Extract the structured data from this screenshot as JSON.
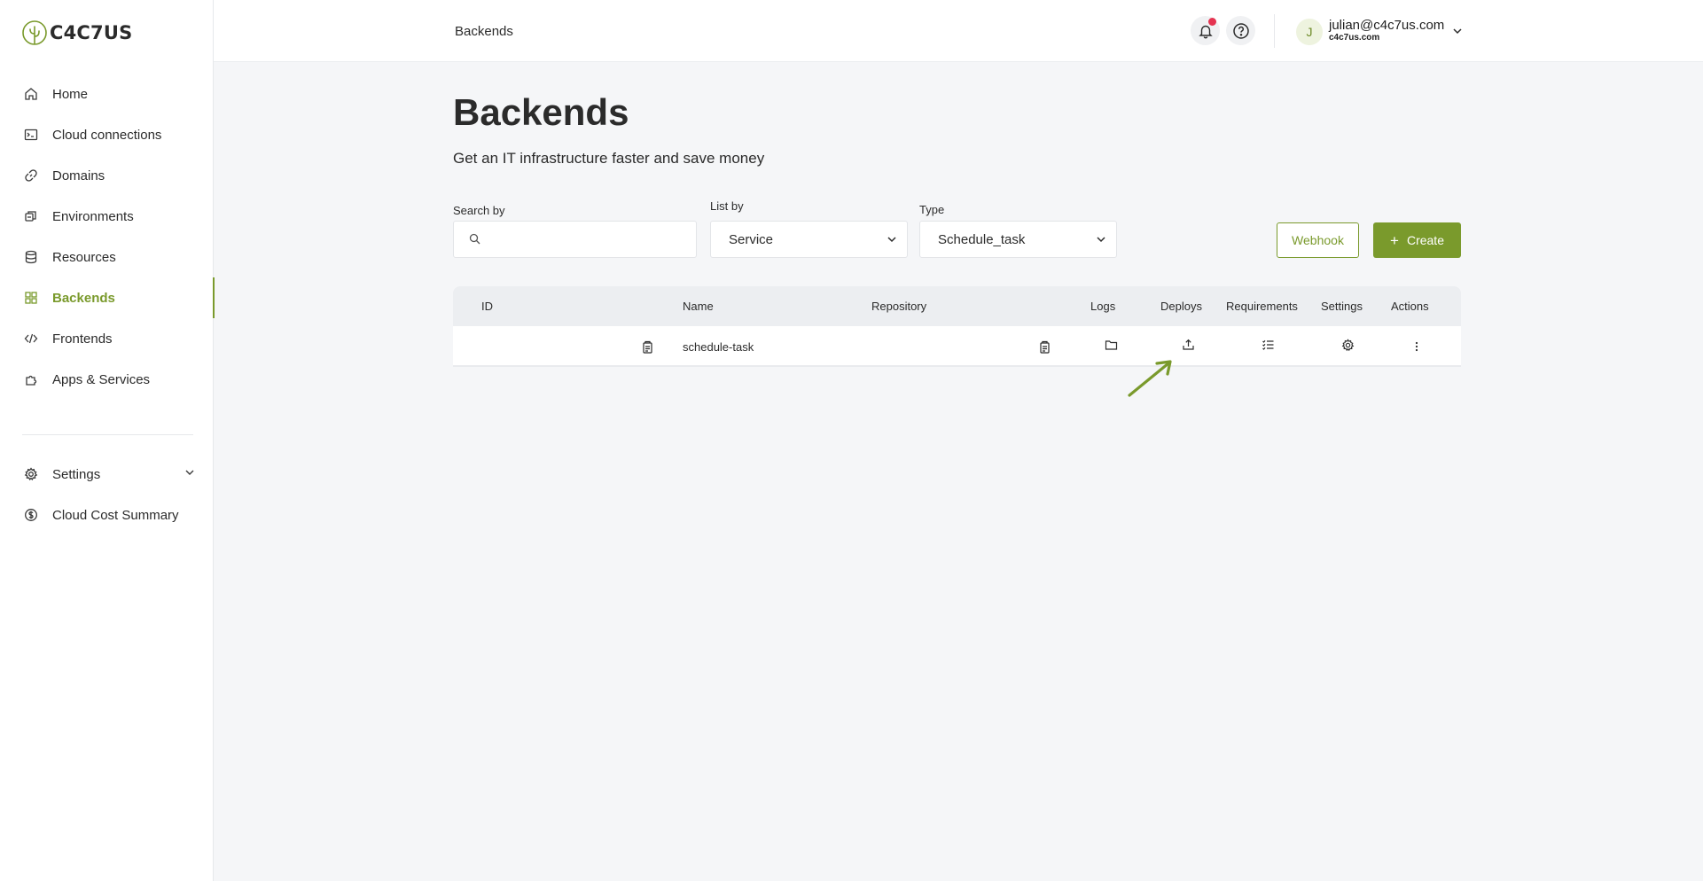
{
  "brand": {
    "name": "C4C7US",
    "accent": "#7a9a2c"
  },
  "sidebar": {
    "items": [
      {
        "label": "Home",
        "icon": "home-icon"
      },
      {
        "label": "Cloud connections",
        "icon": "terminal-icon"
      },
      {
        "label": "Domains",
        "icon": "link-icon"
      },
      {
        "label": "Environments",
        "icon": "environments-icon"
      },
      {
        "label": "Resources",
        "icon": "database-icon"
      },
      {
        "label": "Backends",
        "icon": "grid-icon",
        "active": true
      },
      {
        "label": "Frontends",
        "icon": "code-icon"
      },
      {
        "label": "Apps & Services",
        "icon": "puzzle-icon"
      }
    ],
    "bottom": [
      {
        "label": "Settings",
        "icon": "gear-icon"
      },
      {
        "label": "Cloud Cost Summary",
        "icon": "dollar-icon"
      }
    ]
  },
  "header": {
    "breadcrumb": "Backends",
    "user": {
      "initial": "J",
      "email": "julian@c4c7us.com",
      "org": "c4c7us.com"
    }
  },
  "main": {
    "title": "Backends",
    "subtitle": "Get an IT infrastructure faster and save money",
    "filters": {
      "search_label": "Search by",
      "search_placeholder": "",
      "list_label": "List by",
      "list_value": "Service",
      "type_label": "Type",
      "type_value": "Schedule_task"
    },
    "buttons": {
      "webhook": "Webhook",
      "create": "Create"
    },
    "table": {
      "columns": [
        "ID",
        "Name",
        "Repository",
        "Logs",
        "Deploys",
        "Requirements",
        "Settings",
        "Actions"
      ],
      "rows": [
        {
          "id": "",
          "name": "schedule-task",
          "repository": ""
        }
      ]
    }
  }
}
